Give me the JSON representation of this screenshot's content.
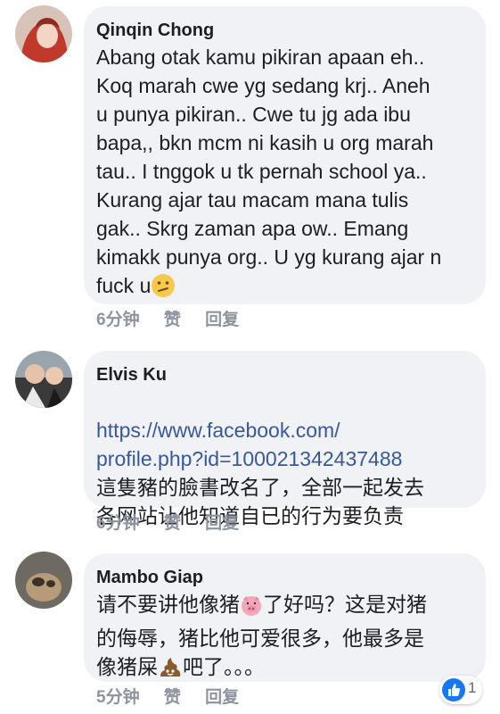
{
  "comments": [
    {
      "author": "Qinqin Chong",
      "text": "Abang otak kamu pikiran apaan eh..\nKoq marah cwe yg sedang krj.. Aneh\nu punya pikiran.. Cwe tu jg ada ibu\nbapa,, bkn mcm ni kasih u org marah\ntau.. I tnggok u tk pernah school ya..\nKurang ajar tau macam mana tulis\ngak.. Skrg zaman apa ow.. Emang\nkimakk punya org.. U yg kurang ajar n\nfuck u",
      "emoji": "confused-face-icon",
      "time": "6分钟",
      "like": "赞",
      "reply": "回复"
    },
    {
      "author": "Elvis Ku",
      "link_line1": "https://www.facebook.com/",
      "link_line2": "profile.php?id=100021342437488",
      "text": "這隻豬的臉書改名了，全部一起发去\n各网站让他知道自已的行为要负责",
      "time": "6分钟",
      "like": "赞",
      "reply": "回复"
    },
    {
      "author": "Mambo Giap",
      "text_part1": "请不要讲他像猪",
      "text_part2": "了好吗？这是对猪\n的侮辱，猪比他可爱很多，他最多是\n像猪屎",
      "text_part3": "吧了。。。",
      "time": "5分钟",
      "like": "赞",
      "reply": "回复",
      "reaction_count": "1"
    }
  ],
  "colors": {
    "bubble": "#f1f2f6",
    "link": "#385898",
    "meta": "#8d949e",
    "like_badge": "#1877f2"
  }
}
